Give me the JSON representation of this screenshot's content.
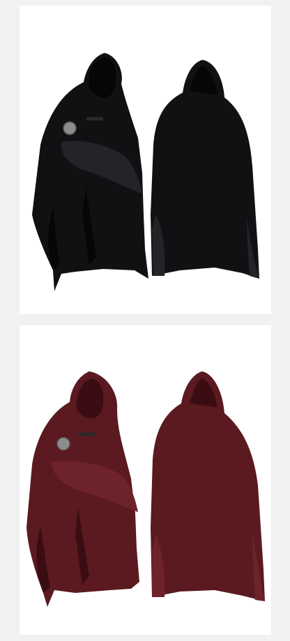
{
  "products": [
    {
      "color_name": "black",
      "main_color": "#111114",
      "shade_color": "#060608",
      "highlight_color": "#232328",
      "views": [
        "front",
        "back"
      ]
    },
    {
      "color_name": "wine red",
      "main_color": "#5a1a20",
      "shade_color": "#3b0d12",
      "highlight_color": "#6e2229",
      "views": [
        "front",
        "back"
      ]
    }
  ],
  "accessories": {
    "brooch_color": "#8c8c8c",
    "clasp_color": "#2a2a2a"
  },
  "background": {
    "page": "#f1f1f1",
    "panel": "#ffffff"
  }
}
